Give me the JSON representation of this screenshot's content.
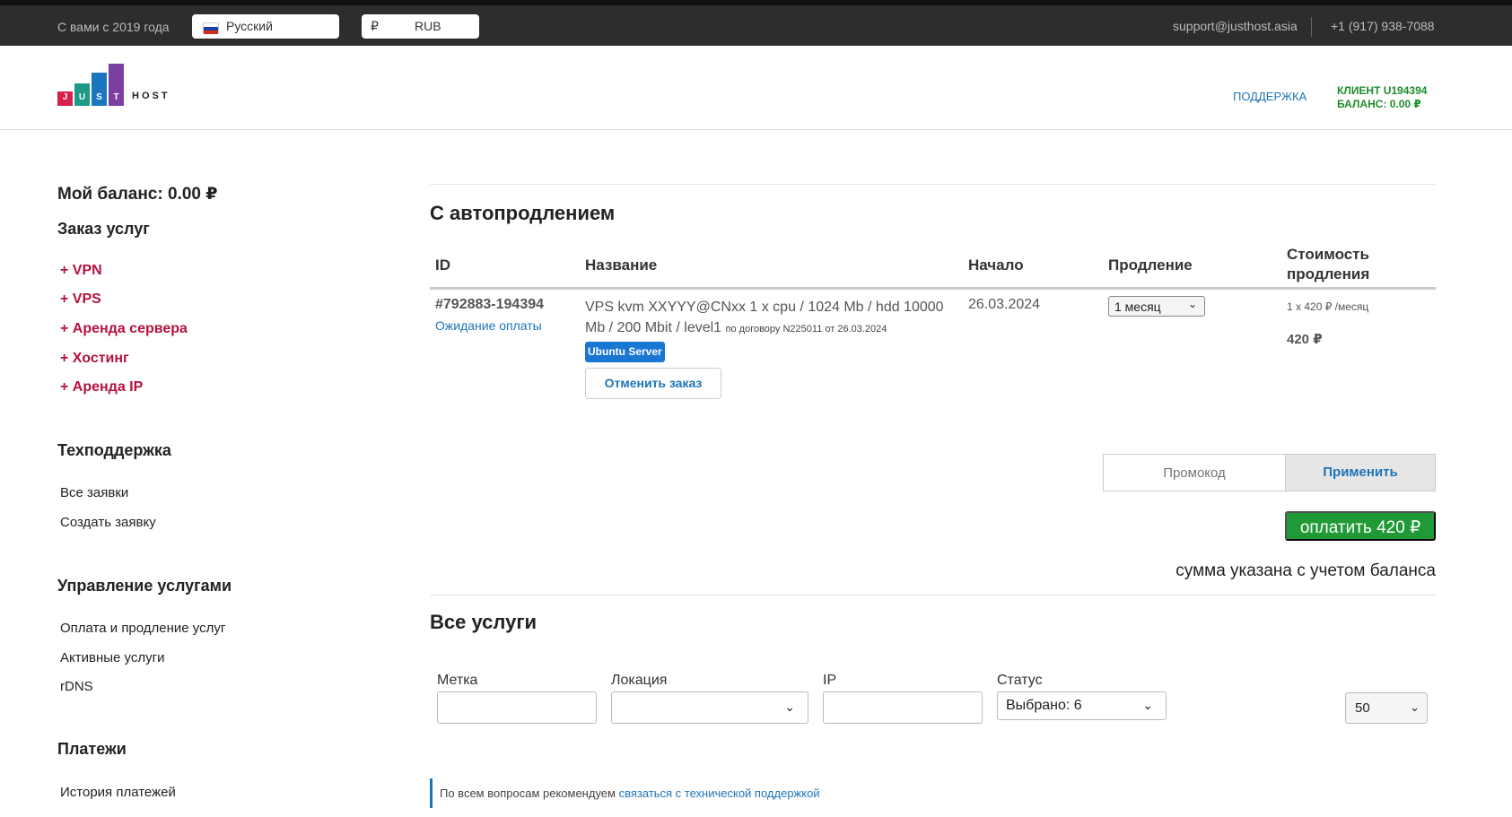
{
  "topbar": {
    "since": "С вами с 2019 года",
    "language": "Русский",
    "currency_symbol": "₽",
    "currency": "RUB",
    "email": "support@justhost.asia",
    "phone": "+1 (917) 938-7088"
  },
  "header": {
    "logo_letters": [
      "J",
      "U",
      "S",
      "T"
    ],
    "logo_host": "HOST",
    "support_link": "ПОДДЕРЖКА",
    "client_line": "КЛИЕНТ U194394",
    "balance_line": "БАЛАНС: 0.00 ₽"
  },
  "sidebar": {
    "balance": "Мой баланс: 0.00 ₽",
    "order_heading": "Заказ услуг",
    "order_items": [
      "+ VPN",
      "+ VPS",
      "+ Аренда сервера",
      "+ Хостинг",
      "+ Аренда IP"
    ],
    "support_heading": "Техподдержка",
    "support_items": [
      "Все заявки",
      "Создать заявку"
    ],
    "manage_heading": "Управление услугами",
    "manage_items": [
      "Оплата и продление услуг",
      "Активные услуги",
      "rDNS"
    ],
    "payments_heading": "Платежи",
    "payments_items": [
      "История платежей"
    ]
  },
  "autorenew": {
    "title": "С автопродлением",
    "columns": [
      "ID",
      "Название",
      "Начало",
      "Продление",
      "Стоимость продления"
    ],
    "row": {
      "id": "#792883-194394",
      "status": "Ожидание оплаты",
      "name": "VPS kvm XXYYY@CNxx 1 x cpu / 1024 Mb / hdd 10000 Mb / 200 Mbit / level1",
      "contract": "по договору N225011 от 26.03.2024",
      "os_badge": "Ubuntu Server",
      "cancel_button": "Отменить заказ",
      "start": "26.03.2024",
      "period": "1 месяц",
      "rate": "1 x 420 ₽ /месяц",
      "total": "420 ₽"
    },
    "promo_placeholder": "Промокод",
    "apply_button": "Применить",
    "pay_button": "оплатить 420 ₽",
    "pay_note": "сумма указана с учетом баланса"
  },
  "all_services": {
    "title": "Все услуги",
    "filters": {
      "tag_label": "Метка",
      "location_label": "Локация",
      "ip_label": "IP",
      "status_label": "Статус",
      "status_value": "Выбрано: 6",
      "per_page": "50"
    },
    "notice_text": "По всем вопросам рекомендуем ",
    "notice_link": "связаться с технической поддержкой"
  },
  "colors": {
    "topbar_bg": "#2d2d2d",
    "accent_blue": "#1e74b8",
    "order_red": "#b5123d",
    "pay_green": "#1f9a36",
    "client_green": "#1f8c2c"
  }
}
